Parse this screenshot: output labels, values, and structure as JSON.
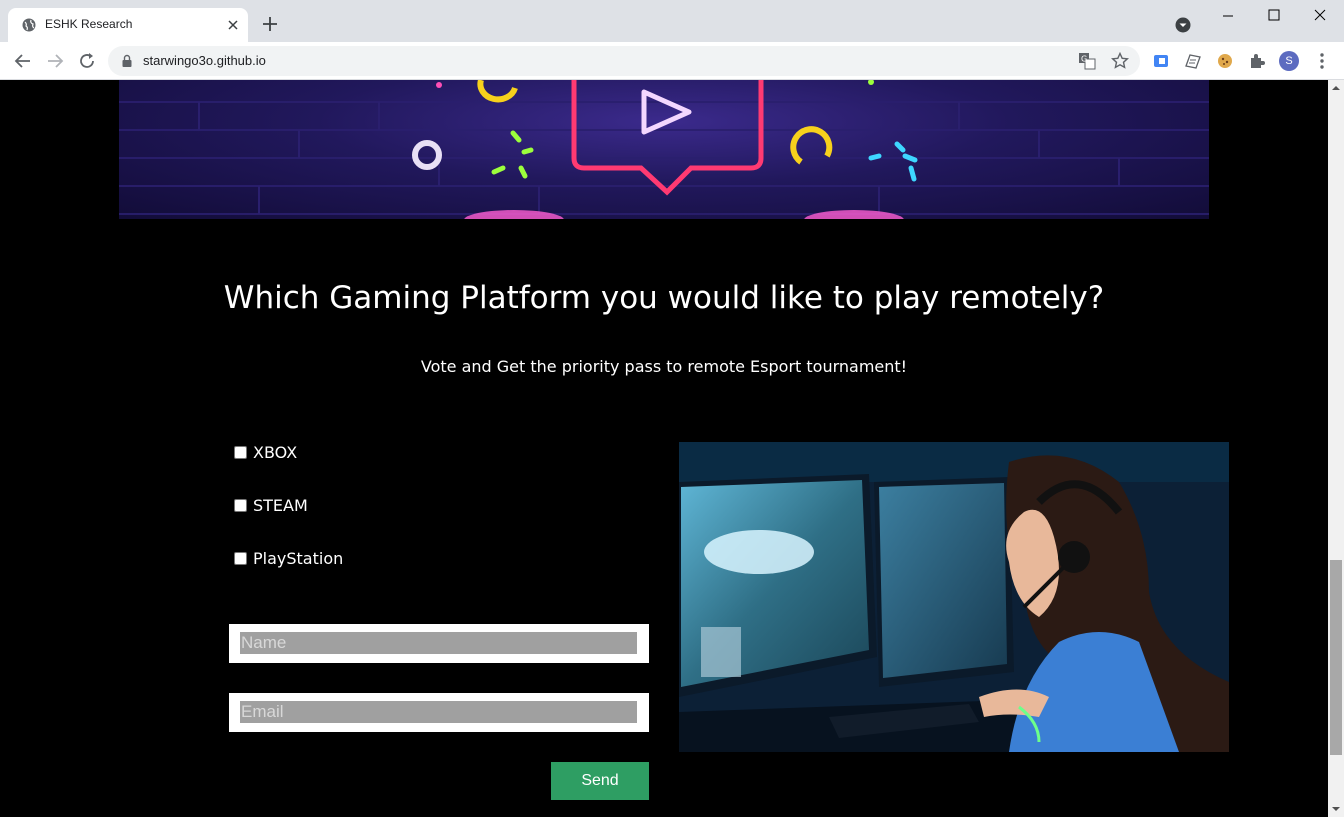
{
  "browser": {
    "tab_title": "ESHK Research",
    "url": "starwingo3o.github.io",
    "profile_initial": "S"
  },
  "page": {
    "heading": "Which Gaming Platform you would like to play remotely?",
    "subheading": "Vote and Get the priority pass to remote Esport tournament!",
    "options": [
      {
        "label": "XBOX",
        "checked": false
      },
      {
        "label": "STEAM",
        "checked": false
      },
      {
        "label": "PlayStation",
        "checked": false
      }
    ],
    "name_placeholder": "Name",
    "email_placeholder": "Email",
    "send_label": "Send"
  },
  "colors": {
    "page_background": "#000000",
    "send_button": "#2e9e63",
    "chrome_titlebar": "#dee1e6"
  }
}
